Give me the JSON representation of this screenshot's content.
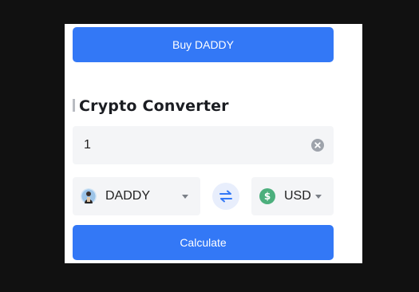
{
  "buy_button": {
    "label": "Buy DADDY"
  },
  "converter": {
    "title": "Crypto Converter",
    "amount": {
      "value": "1"
    },
    "from": {
      "symbol": "DADDY",
      "icon": "daddy-coin-avatar"
    },
    "to": {
      "symbol": "USD",
      "icon": "dollar-icon",
      "glyph": "$"
    },
    "swap": {
      "icon": "swap-arrows-icon"
    }
  },
  "calculate_button": {
    "label": "Calculate"
  },
  "colors": {
    "primary": "#3378f6",
    "field_bg": "#f4f5f7",
    "usd_green": "#4caf7d",
    "swap_bg": "#e8eefc"
  }
}
